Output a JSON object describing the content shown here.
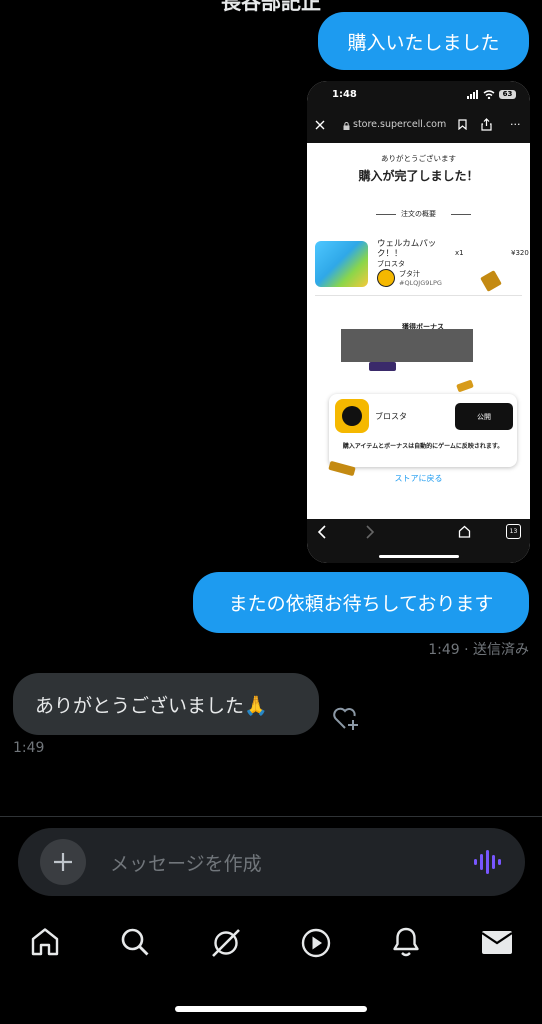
{
  "header": {
    "title": "長谷部記正"
  },
  "messages": {
    "out1": "購入いたしました",
    "out2": "またの依頼お待ちしております",
    "out2_meta": "1:49 · 送信済み",
    "in1": "ありがとうございました🙏",
    "in1_time": "1:49"
  },
  "screenshot": {
    "status_time": "1:48",
    "battery": "63",
    "url": "store.supercell.com",
    "thanks": "ありがとうございます",
    "heading": "購入が完了しました！",
    "summary_label": "注文の概要",
    "item_name": "ウェルカムパック！！",
    "item_game": "ブロスタ",
    "item_qty": "x1",
    "item_price": "¥320",
    "player_name": "ブタ汁",
    "player_tag": "#QLQJG9LPG",
    "bonus_label": "獲得ボーナス",
    "app_name": "ブロスタ",
    "open_button": "公開",
    "notice": "購入アイテムとボーナスは自動的にゲームに反映されます。",
    "back_link": "ストアに戻る",
    "tab_count": "13"
  },
  "composer": {
    "placeholder": "メッセージを作成"
  },
  "colors": {
    "accent": "#1d9bf0",
    "background": "#000000",
    "incoming": "#2f3336"
  }
}
